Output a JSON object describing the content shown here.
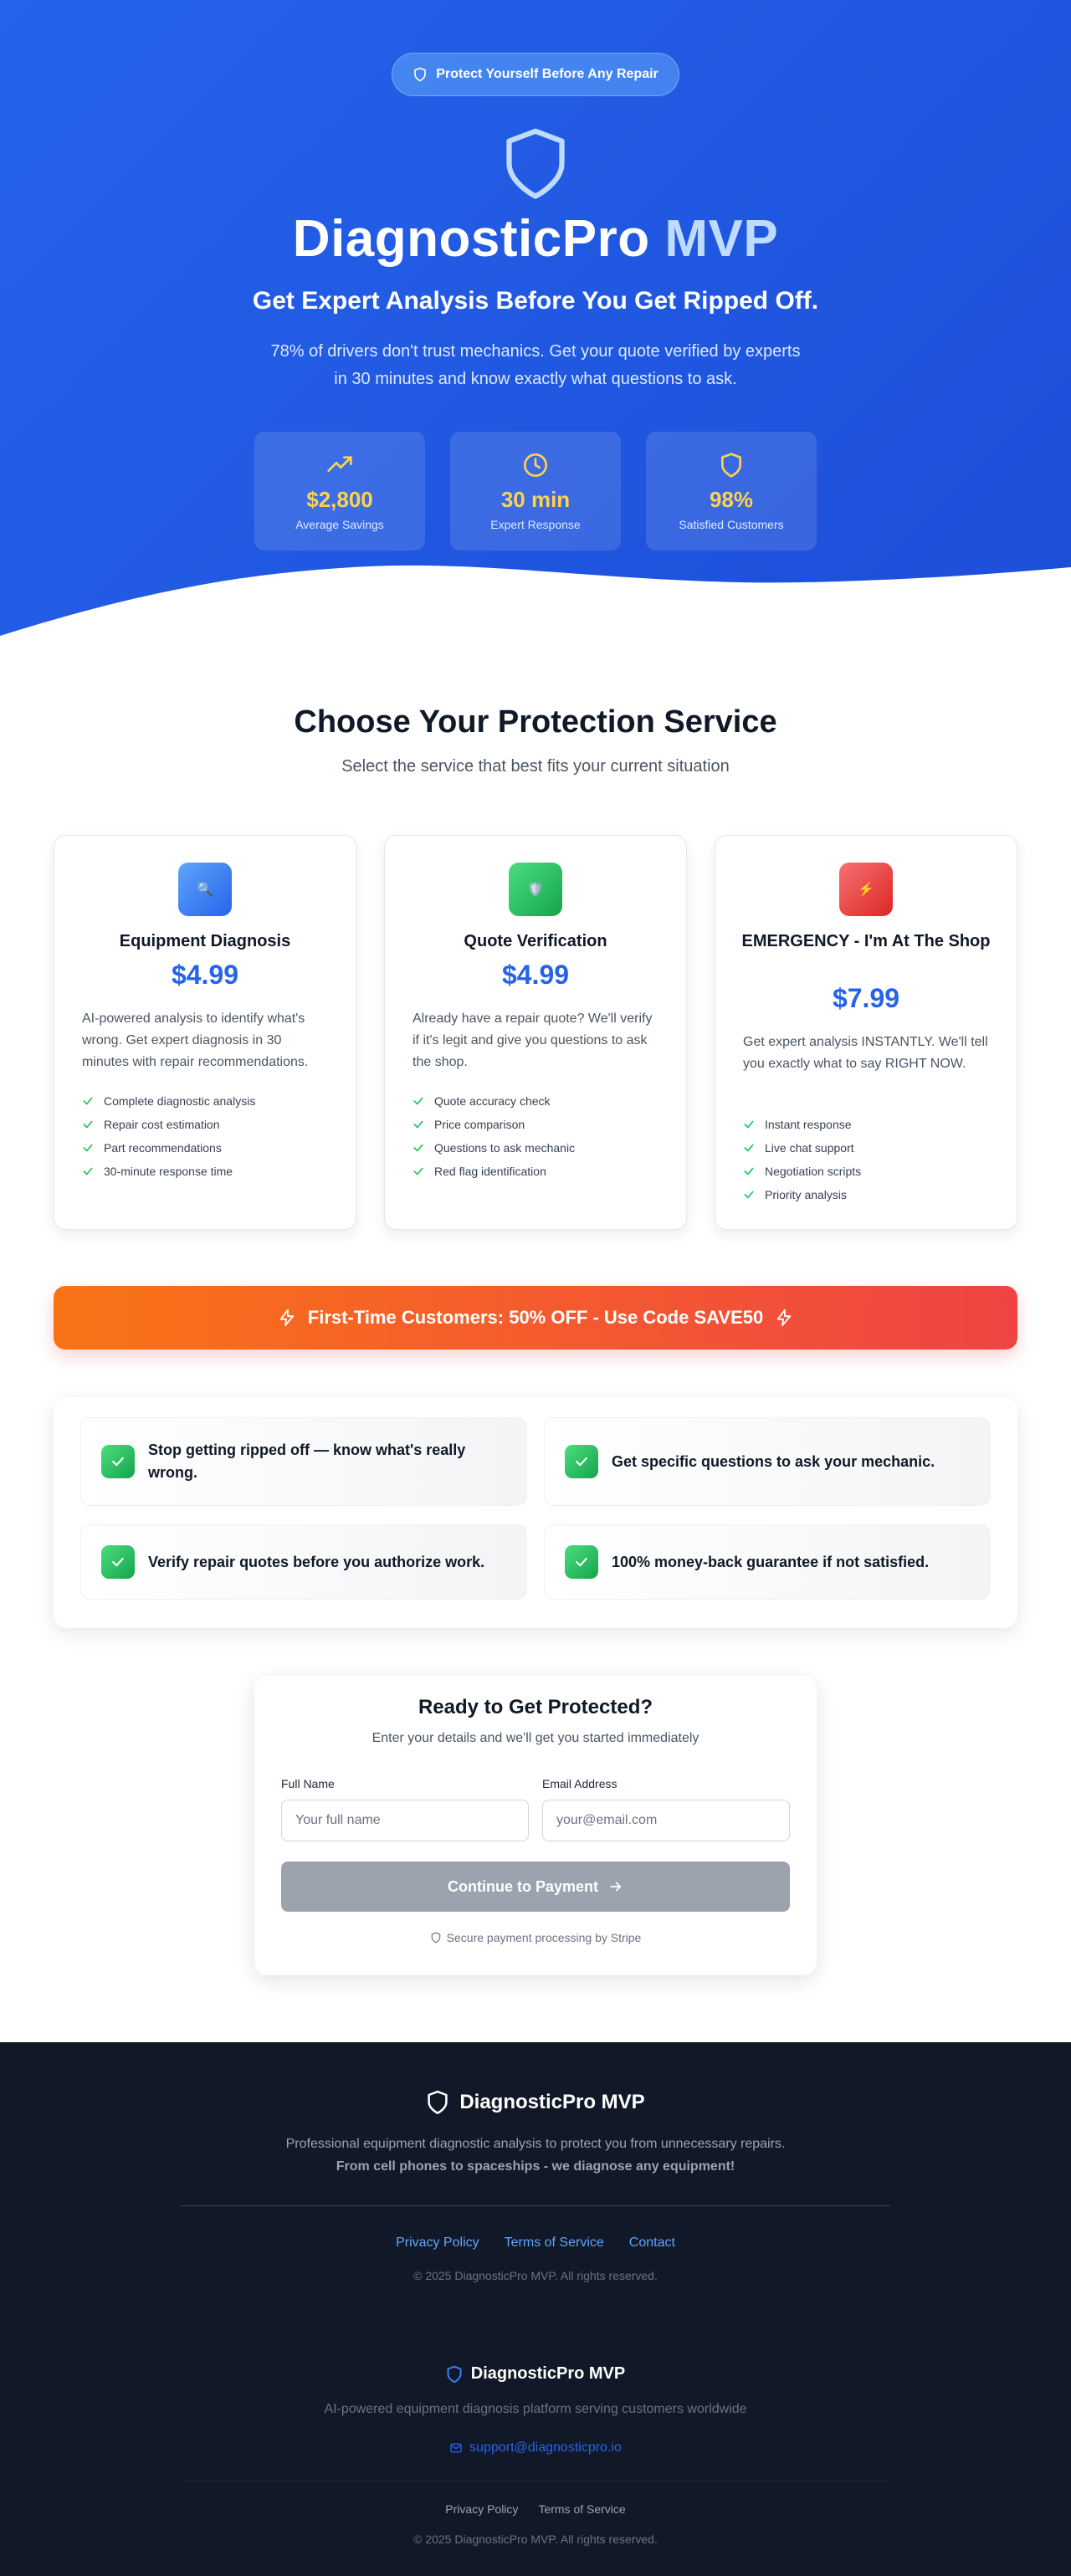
{
  "hero": {
    "badge": "Protect Yourself Before Any Repair",
    "title_main": "DiagnosticPro",
    "title_accent": "MVP",
    "subtitle": "Get Expert Analysis Before You Get Ripped Off.",
    "description": "78% of drivers don't trust mechanics. Get your quote verified by experts in 30 minutes and know exactly what questions to ask.",
    "stats": [
      {
        "icon": "trending-up-icon",
        "value": "$2,800",
        "label": "Average Savings"
      },
      {
        "icon": "clock-icon",
        "value": "30 min",
        "label": "Expert Response"
      },
      {
        "icon": "shield-icon",
        "value": "98%",
        "label": "Satisfied Customers"
      }
    ]
  },
  "services": {
    "title": "Choose Your Protection Service",
    "subtitle": "Select the service that best fits your current situation",
    "cards": [
      {
        "icon": "magnifier-icon",
        "icon_glyph": "🔍",
        "icon_color": "#3b82f6",
        "title": "Equipment Diagnosis",
        "price": "$4.99",
        "description": "AI-powered analysis to identify what's wrong. Get expert diagnosis in 30 minutes with repair recommendations.",
        "features": [
          "Complete diagnostic analysis",
          "Repair cost estimation",
          "Part recommendations",
          "30-minute response time"
        ]
      },
      {
        "icon": "shield-icon",
        "icon_glyph": "🛡️",
        "icon_color": "#22c55e",
        "title": "Quote Verification",
        "price": "$4.99",
        "description": "Already have a repair quote? We'll verify if it's legit and give you questions to ask the shop.",
        "features": [
          "Quote accuracy check",
          "Price comparison",
          "Questions to ask mechanic",
          "Red flag identification"
        ]
      },
      {
        "icon": "lightning-icon",
        "icon_glyph": "⚡",
        "icon_color": "#ef4444",
        "title": "EMERGENCY - I'm At The Shop",
        "price": "$7.99",
        "description": "Get expert analysis INSTANTLY. We'll tell you exactly what to say RIGHT NOW.",
        "features": [
          "Instant response",
          "Live chat support",
          "Negotiation scripts",
          "Priority analysis"
        ]
      }
    ]
  },
  "promo": {
    "text": "First-Time Customers: 50% OFF - Use Code SAVE50"
  },
  "benefits": [
    "Stop getting ripped off — know what's really wrong.",
    "Get specific questions to ask your mechanic.",
    "Verify repair quotes before you authorize work.",
    "100% money-back guarantee if not satisfied."
  ],
  "form": {
    "title": "Ready to Get Protected?",
    "subtitle": "Enter your details and we'll get you started immediately",
    "name_label": "Full Name",
    "name_placeholder": "Your full name",
    "email_label": "Email Address",
    "email_placeholder": "your@email.com",
    "button": "Continue to Payment",
    "secure_note": "Secure payment processing by Stripe"
  },
  "footer": {
    "brand": "DiagnosticPro MVP",
    "description": "Professional equipment diagnostic analysis to protect you from unnecessary repairs.",
    "tagline": "From cell phones to spaceships - we diagnose any equipment!",
    "links": [
      "Privacy Policy",
      "Terms of Service",
      "Contact"
    ],
    "copyright": "© 2025 DiagnosticPro MVP. All rights reserved."
  },
  "footer2": {
    "brand": "DiagnosticPro MVP",
    "description": "AI-powered equipment diagnosis platform serving customers worldwide",
    "email": "support@diagnosticpro.io",
    "links": [
      "Privacy Policy",
      "Terms of Service"
    ],
    "copyright": "© 2025 DiagnosticPro MVP. All rights reserved."
  },
  "colors": {
    "primary": "#2563eb",
    "accent_yellow": "#fcd34d",
    "success": "#22c55e",
    "danger": "#ef4444",
    "orange": "#f97316",
    "footer_bg": "#111827",
    "link_blue": "#60a5fa"
  }
}
